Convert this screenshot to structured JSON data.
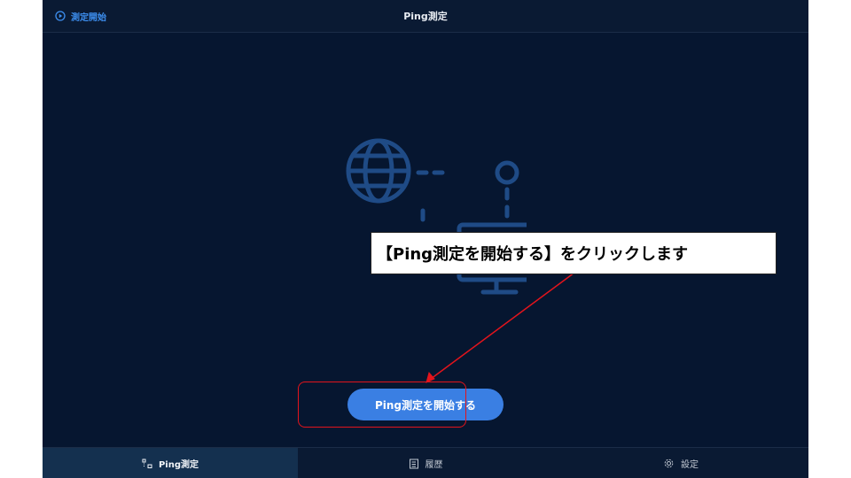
{
  "topbar": {
    "start_label": "測定開始",
    "title": "Ping測定"
  },
  "main": {
    "start_button_label": "Ping測定を開始する"
  },
  "tabs": [
    {
      "label": "Ping測定",
      "icon": "ping-icon",
      "active": true
    },
    {
      "label": "履歴",
      "icon": "history-icon",
      "active": false
    },
    {
      "label": "設定",
      "icon": "gear-icon",
      "active": false
    }
  ],
  "annotation": {
    "callout_text": "【Ping測定を開始する】をクリックします"
  },
  "colors": {
    "background": "#061630",
    "accent": "#3a7fe3",
    "illustration": "#1f4b86",
    "highlight": "#e3141c"
  }
}
